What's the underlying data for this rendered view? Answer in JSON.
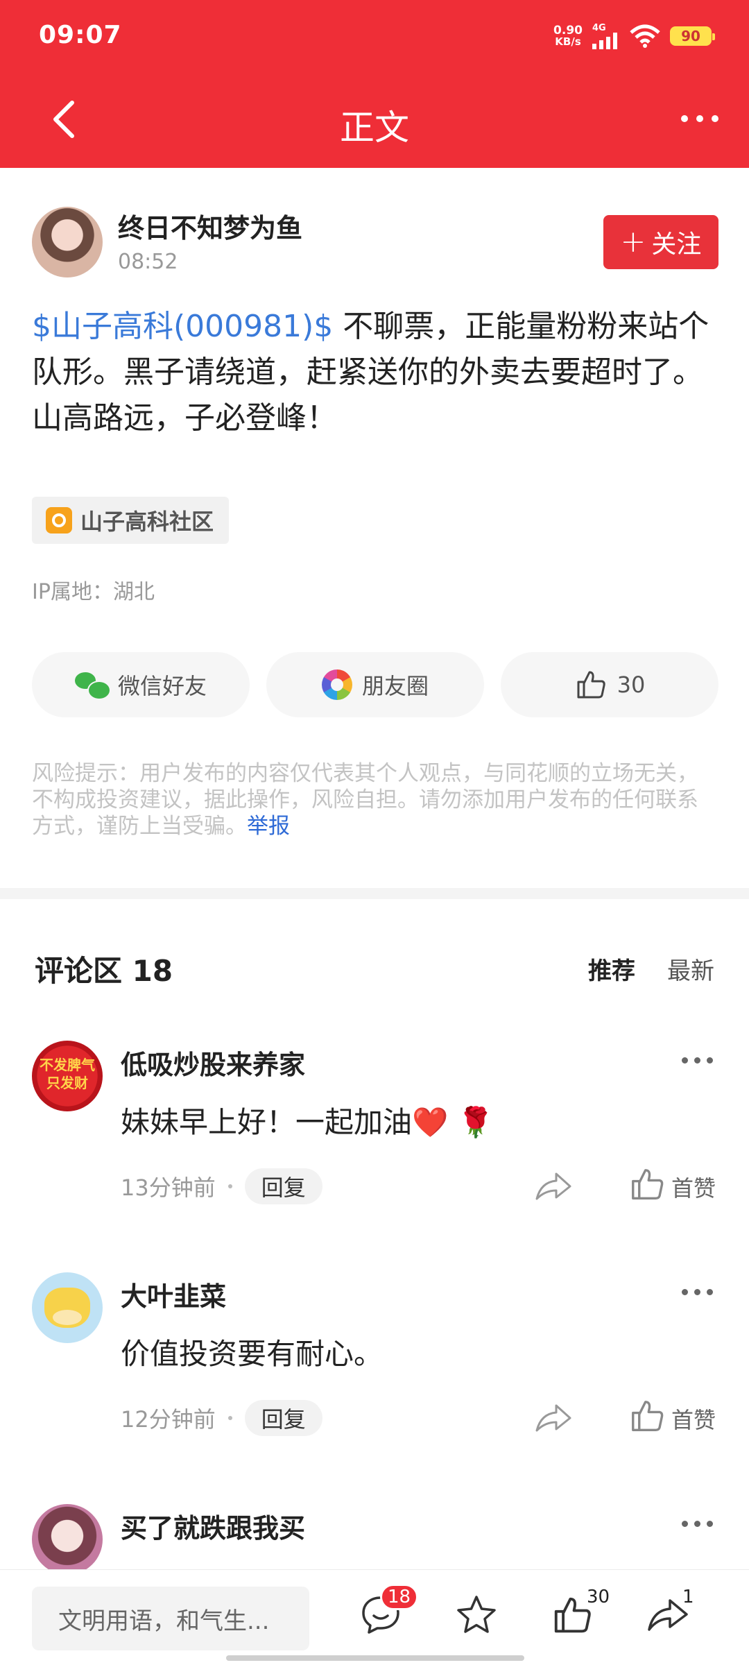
{
  "status_bar": {
    "time": "09:07",
    "net_speed": "0.90",
    "net_unit": "KB/s",
    "network": "4G",
    "battery": "90"
  },
  "nav": {
    "title": "正文"
  },
  "post": {
    "author": "终日不知梦为鱼",
    "time": "08:52",
    "follow_label": "关注",
    "stock_tag": "$山子高科(000981)$",
    "text": " 不聊票，正能量粉粉来站个队形。黑子请绕道，赶紧送你的外卖去要超时了。山高路远，子必登峰！",
    "community": "山子高科社区",
    "ip": "IP属地：湖北",
    "share_wechat": "微信好友",
    "share_moments": "朋友圈",
    "like_count": "30",
    "risk_text": "风险提示：用户发布的内容仅代表其个人观点，与同花顺的立场无关，不构成投资建议，据此操作，风险自担。请勿添加用户发布的任何联系方式，谨防上当受骗。",
    "report_label": "举报"
  },
  "comments_section": {
    "title": "评论区 18",
    "sort_recommended": "推荐",
    "sort_latest": "最新",
    "items": [
      {
        "name": "低吸炒股来养家",
        "text": "妹妹早上好！一起加油❤️ 🌹",
        "time": "13分钟前",
        "reply": "回复",
        "like": "首赞",
        "avatar_text": "不发脾气只发财"
      },
      {
        "name": "大叶韭菜",
        "text": "价值投资要有耐心。",
        "time": "12分钟前",
        "reply": "回复",
        "like": "首赞"
      },
      {
        "name": "买了就跌跟我买"
      }
    ]
  },
  "bottom_bar": {
    "input_placeholder": "文明用语，和气生...",
    "comment_badge": "18",
    "like_count": "30",
    "share_count": "1"
  }
}
